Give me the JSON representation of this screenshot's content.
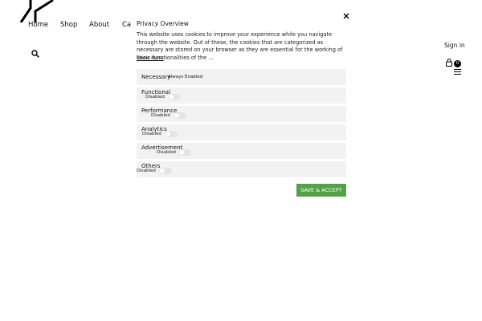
{
  "nav": {
    "items": [
      "Home",
      "Shop",
      "About",
      "Ca"
    ],
    "sign_in": "Sign in",
    "cart_count": "0"
  },
  "privacy": {
    "title": "Privacy Overview",
    "description": "This website uses cookies to improve your experience while you navigate through the website. Out of these, the cookies that are categorized as necessary are stored on your browser as they are essential for the working of basic functionalities of the ...",
    "show_more": "Show more",
    "necessary": {
      "name": "Necessary",
      "status": "Always Enabled"
    },
    "categories": [
      {
        "name": "Functional",
        "state": "Disabled"
      },
      {
        "name": "Performance",
        "state": "Disabled"
      },
      {
        "name": "Analytics",
        "state": "Disabled"
      },
      {
        "name": "Advertisement",
        "state": "Disabled"
      },
      {
        "name": "Others",
        "state": "Disabled"
      }
    ],
    "accept_label": "SAVE & ACCEPT"
  },
  "colors": {
    "accept_button": "#56a148",
    "row_background": "#f2f2f2",
    "toggle_off": "#e4e4e4"
  },
  "icons": [
    "logo-mark",
    "search-icon",
    "close-icon",
    "cart-icon",
    "hamburger-menu-icon"
  ]
}
